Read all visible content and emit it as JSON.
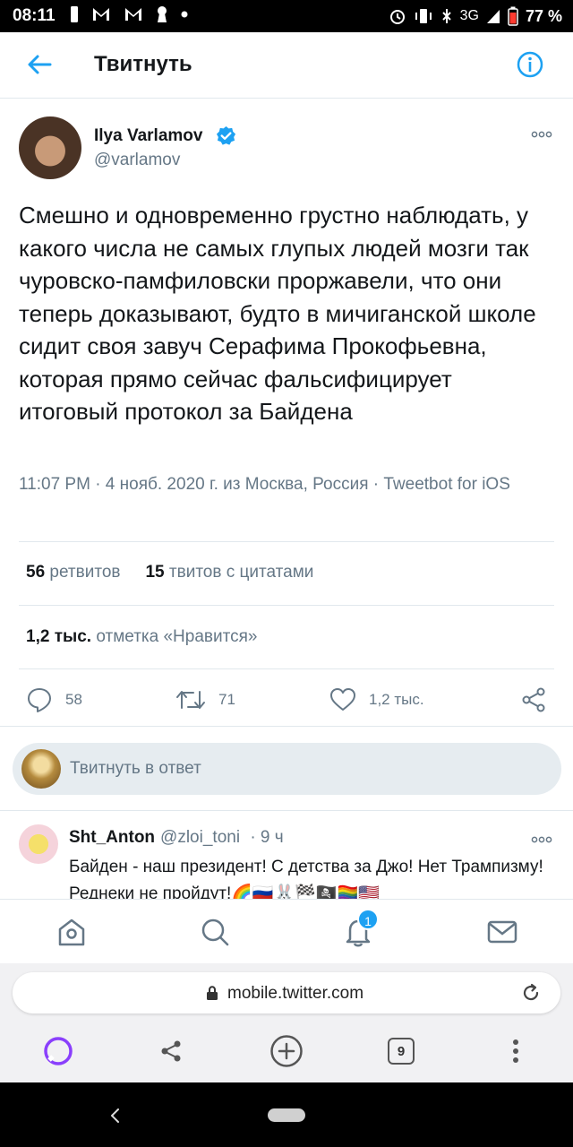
{
  "status_bar": {
    "time": "08:11",
    "network": "3G",
    "battery": "77 %"
  },
  "header": {
    "title": "Твитнуть"
  },
  "tweet": {
    "author_name": "Ilya Varlamov",
    "handle": "@varlamov",
    "text": "Смешно и одновременно грустно наблюдать, у какого числа не самых глупых людей мозги так чуровско-памфиловски проржавели, что они теперь доказывают, будто в мичиганской школе сидит своя завуч Серафима Прокофьевна, которая прямо сейчас фальсифицирует итоговый протокол за Байдена",
    "meta": "11:07 PM · 4 нояб. 2020 г. из Москва, Россия · Tweetbot for iOS",
    "retweets_count": "56",
    "retweets_label": "ретвитов",
    "quotes_count": "15",
    "quotes_label": "твитов с цитатами",
    "likes_count": "1,2 тыс.",
    "likes_label": "отметка «Нравится»"
  },
  "actions": {
    "replies": "58",
    "retweets": "71",
    "likes": "1,2 тыс."
  },
  "reply_box": {
    "placeholder": "Твитнуть в ответ"
  },
  "reply": {
    "name": "Sht_Anton",
    "handle": "@zloi_toni",
    "time": "· 9 ч",
    "text": "Байден - наш президент! С детства за Джо! Нет Трампизму! Реднеки не пройдут!🌈🇷🇺🐰🏁🏴‍☠️🏳️‍🌈🇺🇸"
  },
  "bottom_nav": {
    "notifications_badge": "1"
  },
  "browser": {
    "url": "mobile.twitter.com",
    "tabs_count": "9"
  },
  "colors": {
    "accent": "#1da1f2",
    "secondary_text": "#657786",
    "alice_purple": "#8a3ffc"
  }
}
